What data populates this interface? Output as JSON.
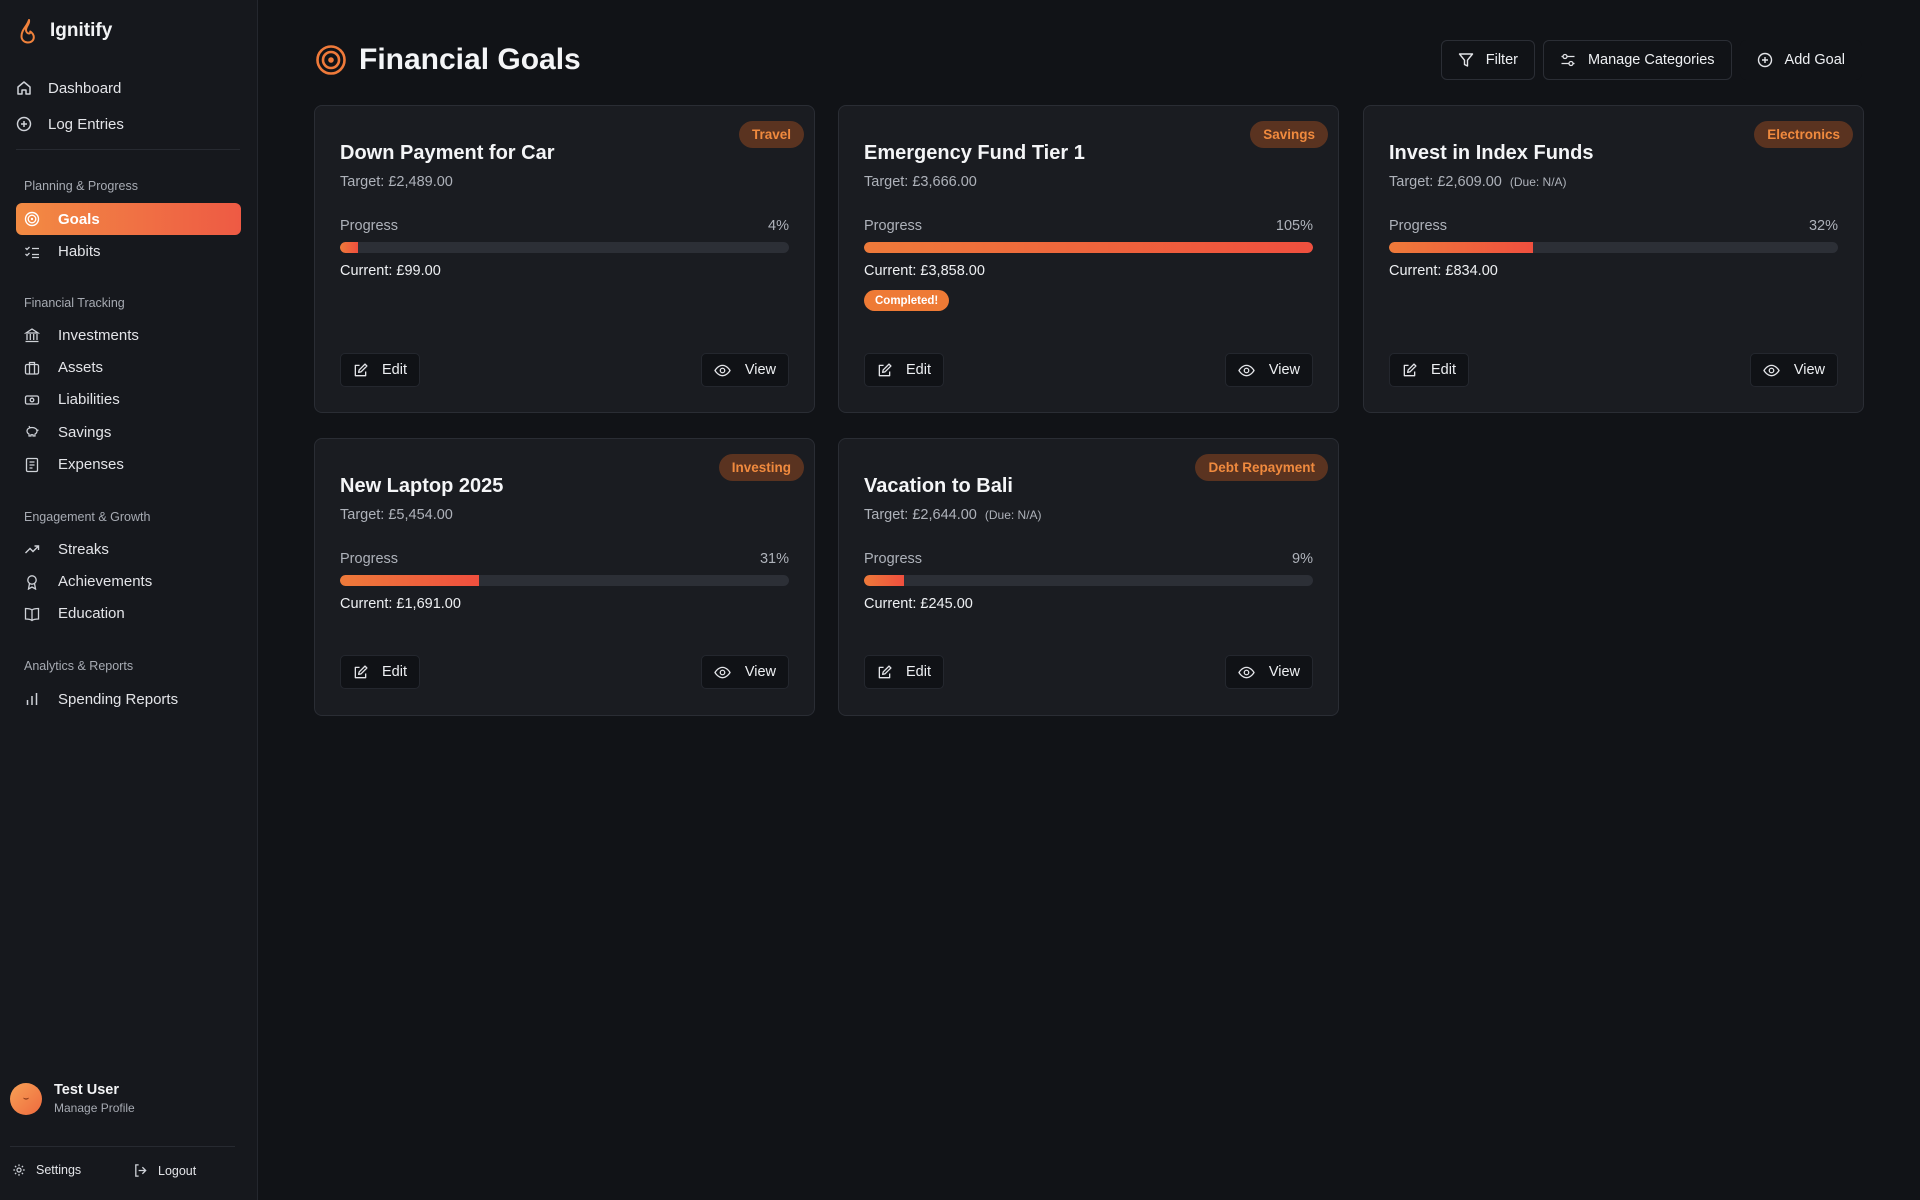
{
  "app": {
    "name": "Ignitify"
  },
  "sidebar": {
    "top_items": [
      {
        "label": "Dashboard",
        "icon": "home-icon"
      },
      {
        "label": "Log Entries",
        "icon": "plus-circle-icon"
      }
    ],
    "sections": [
      {
        "title": "Planning & Progress",
        "items": [
          {
            "label": "Goals",
            "icon": "target-icon",
            "active": true
          },
          {
            "label": "Habits",
            "icon": "checklist-icon"
          }
        ]
      },
      {
        "title": "Financial Tracking",
        "items": [
          {
            "label": "Investments",
            "icon": "bank-icon"
          },
          {
            "label": "Assets",
            "icon": "briefcase-icon"
          },
          {
            "label": "Liabilities",
            "icon": "banknote-icon"
          },
          {
            "label": "Savings",
            "icon": "piggy-bank-icon"
          },
          {
            "label": "Expenses",
            "icon": "receipt-icon"
          }
        ]
      },
      {
        "title": "Engagement & Growth",
        "items": [
          {
            "label": "Streaks",
            "icon": "trending-up-icon"
          },
          {
            "label": "Achievements",
            "icon": "award-icon"
          },
          {
            "label": "Education",
            "icon": "book-icon"
          }
        ]
      },
      {
        "title": "Analytics & Reports",
        "items": [
          {
            "label": "Spending Reports",
            "icon": "bar-chart-icon"
          }
        ]
      }
    ],
    "user": {
      "name": "Test User",
      "subtitle": "Manage Profile"
    },
    "footer": {
      "settings": "Settings",
      "logout": "Logout"
    }
  },
  "header": {
    "title": "Financial Goals",
    "actions": {
      "filter": "Filter",
      "manage": "Manage Categories",
      "add": "Add Goal"
    }
  },
  "goals": [
    {
      "title": "Down Payment for Car",
      "category": "Travel",
      "target": "Target: £2,489.00",
      "due": "",
      "progress_label": "Progress",
      "progress_text": "4%",
      "progress": 0.04,
      "current": "Current: £99.00",
      "badge": ""
    },
    {
      "title": "Emergency Fund Tier 1",
      "category": "Savings",
      "target": "Target: £3,666.00",
      "due": "",
      "progress_label": "Progress",
      "progress_text": "105%",
      "progress": 1.0,
      "current": "Current: £3,858.00",
      "badge": "Completed!"
    },
    {
      "title": "Invest in Index Funds",
      "category": "Electronics",
      "target": "Target: £2,609.00",
      "due": "(Due: N/A)",
      "progress_label": "Progress",
      "progress_text": "32%",
      "progress": 0.32,
      "current": "Current: £834.00",
      "badge": ""
    },
    {
      "title": "New Laptop 2025",
      "category": "Investing",
      "target": "Target: £5,454.00",
      "due": "",
      "progress_label": "Progress",
      "progress_text": "31%",
      "progress": 0.31,
      "current": "Current: £1,691.00",
      "badge": ""
    },
    {
      "title": "Vacation to Bali",
      "category": "Debt Repayment",
      "target": "Target: £2,644.00",
      "due": "(Due: N/A)",
      "progress_label": "Progress",
      "progress_text": "9%",
      "progress": 0.09,
      "current": "Current: £245.00",
      "badge": ""
    }
  ],
  "card_actions": {
    "edit": "Edit",
    "view": "View"
  },
  "colors": {
    "accent": "#ef6a3e",
    "accent_start": "#f28b43",
    "background": "#111317",
    "card": "#1a1c21"
  }
}
